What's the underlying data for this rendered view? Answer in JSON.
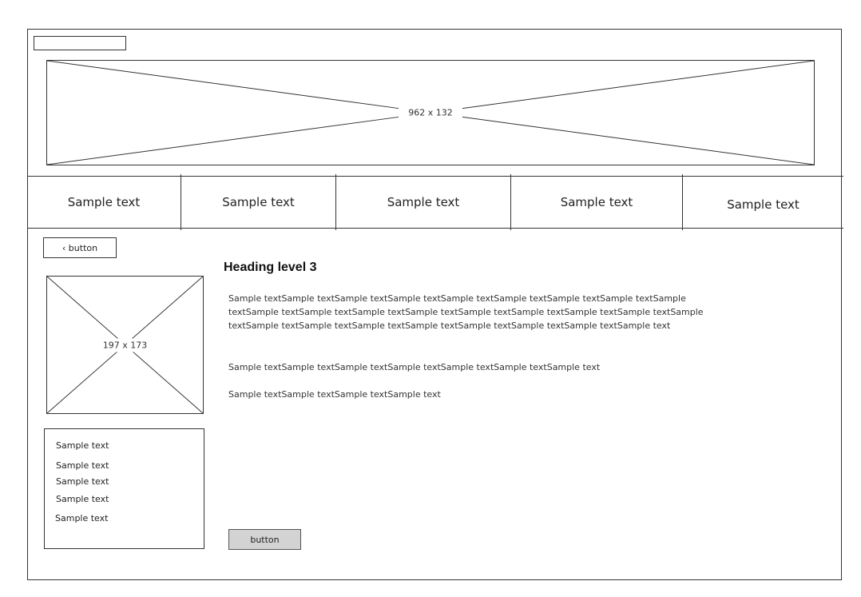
{
  "banner": {
    "label": "962 x 132"
  },
  "nav": {
    "items": [
      {
        "label": "Sample text"
      },
      {
        "label": "Sample text"
      },
      {
        "label": "Sample text"
      },
      {
        "label": "Sample text"
      },
      {
        "label": "Sample text"
      }
    ]
  },
  "sidebar": {
    "back_button_label": "‹ button",
    "image_label": "197 x 173",
    "list": [
      "Sample text",
      "Sample text",
      "Sample text",
      "Sample text",
      "Sample text"
    ]
  },
  "main": {
    "heading": "Heading level 3",
    "paragraphs": [
      "Sample textSample textSample textSample textSample textSample textSample textSample textSample textSample textSample textSample textSample textSample textSample textSample textSample textSample textSample textSample textSample textSample textSample textSample textSample textSample text",
      "Sample textSample textSample textSample textSample textSample textSample text",
      "Sample textSample textSample textSample text"
    ],
    "button_label": "button"
  }
}
